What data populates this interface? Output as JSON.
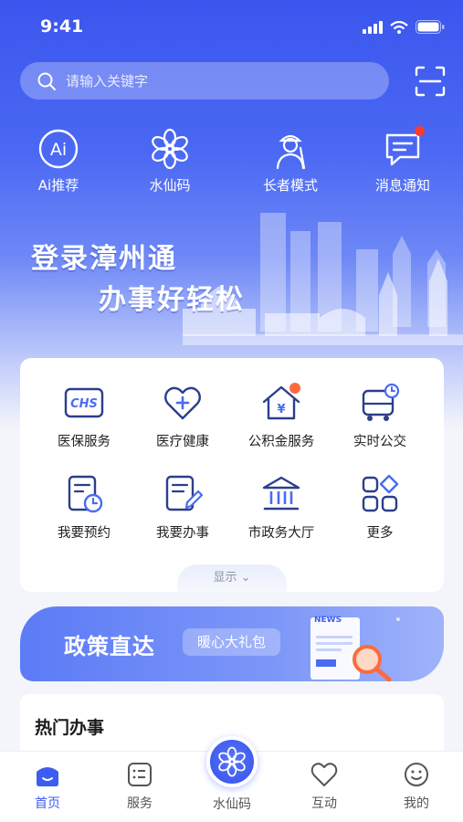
{
  "status_bar": {
    "time": "9:41"
  },
  "search": {
    "placeholder": "请输入关键字"
  },
  "quick_actions": [
    {
      "label": "Ai推荐",
      "icon": "ai-icon"
    },
    {
      "label": "水仙码",
      "icon": "narcissus-icon"
    },
    {
      "label": "长者模式",
      "icon": "elder-icon"
    },
    {
      "label": "消息通知",
      "icon": "message-icon"
    }
  ],
  "slogan": {
    "line1": "登录漳州通",
    "line2": "办事好轻松"
  },
  "services": [
    {
      "label": "医保服务",
      "icon": "chs-icon"
    },
    {
      "label": "医疗健康",
      "icon": "heart-plus-icon"
    },
    {
      "label": "公积金服务",
      "icon": "house-fund-icon"
    },
    {
      "label": "实时公交",
      "icon": "bus-icon"
    },
    {
      "label": "我要预约",
      "icon": "appointment-icon"
    },
    {
      "label": "我要办事",
      "icon": "task-icon"
    },
    {
      "label": "市政务大厅",
      "icon": "government-hall-icon"
    },
    {
      "label": "更多",
      "icon": "more-icon"
    }
  ],
  "show_toggle": {
    "label": "显示"
  },
  "banner": {
    "title": "政策直达",
    "pill": "暖心大礼包",
    "news_tag": "NEWS"
  },
  "hot": {
    "title": "热门办事"
  },
  "tabbar": [
    {
      "label": "首页",
      "icon": "home-icon",
      "active": true
    },
    {
      "label": "服务",
      "icon": "service-icon",
      "active": false
    },
    {
      "label": "水仙码",
      "icon": "narcissus-icon",
      "active": false
    },
    {
      "label": "互动",
      "icon": "heart-icon",
      "active": false
    },
    {
      "label": "我的",
      "icon": "smile-icon",
      "active": false
    }
  ],
  "colors": {
    "primary": "#3d5cf0",
    "hero_top": "#3b56ee",
    "icon_navy": "#2c3e8c",
    "badge": "#ff3b30"
  }
}
